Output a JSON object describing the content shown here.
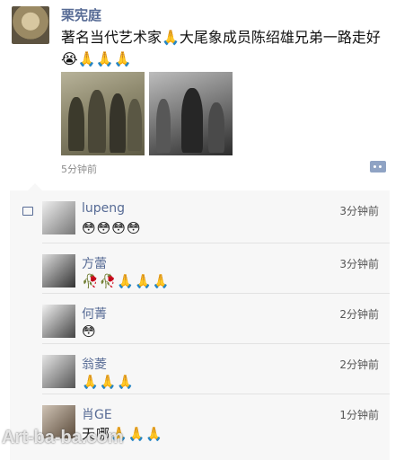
{
  "post": {
    "author": "栗宪庭",
    "text": "著名当代艺术家🙏大尾象成员陈绍雄兄弟一路走好😭🙏🙏🙏",
    "time": "5分钟前"
  },
  "comments": [
    {
      "name": "lupeng",
      "time": "3分钟前",
      "text": "😳😳😳😳"
    },
    {
      "name": "方蕾",
      "time": "3分钟前",
      "text": "🥀🥀🙏🙏🙏"
    },
    {
      "name": "何菁",
      "time": "2分钟前",
      "text": "😳"
    },
    {
      "name": "翁菱",
      "time": "2分钟前",
      "text": "🙏🙏🙏"
    },
    {
      "name": "肖GE",
      "time": "1分钟前",
      "text": "天哪🙏🙏🙏"
    }
  ],
  "watermark": "Art-ba-ba.com"
}
